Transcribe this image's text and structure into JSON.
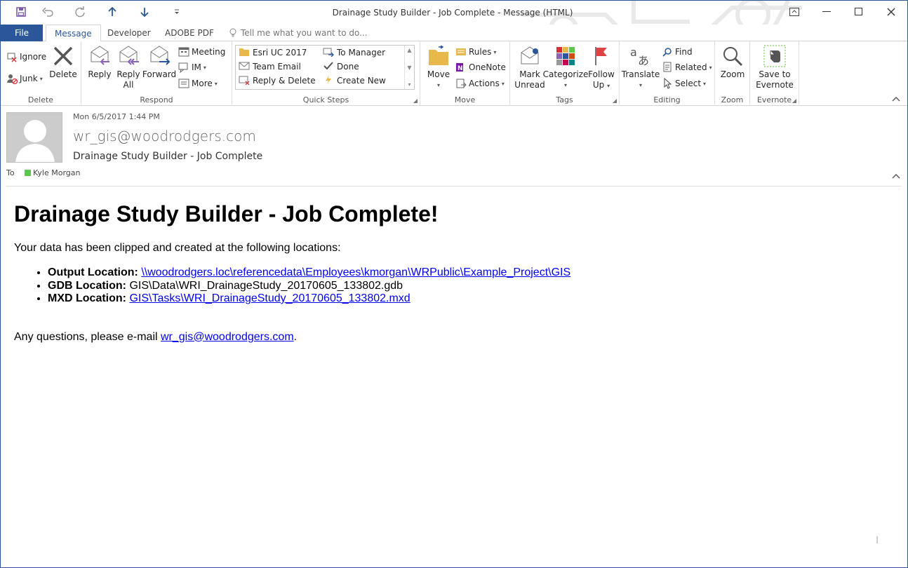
{
  "window": {
    "title": "Drainage Study Builder - Job Complete - Message (HTML)"
  },
  "qat": {
    "save_icon": "save-icon",
    "undo_icon": "undo-icon",
    "redo_icon": "redo-icon",
    "up_icon": "arrow-up-icon",
    "down_icon": "arrow-down-icon",
    "customize_icon": "customize-qat-icon"
  },
  "tabs": {
    "file": "File",
    "message": "Message",
    "developer": "Developer",
    "adobe": "ADOBE PDF",
    "tell_me": "Tell me what you want to do..."
  },
  "ribbon": {
    "delete_group": {
      "label": "Delete",
      "ignore": "Ignore",
      "junk": "Junk",
      "delete": "Delete"
    },
    "respond_group": {
      "label": "Respond",
      "reply": "Reply",
      "reply_all_1": "Reply",
      "reply_all_2": "All",
      "forward": "Forward",
      "meeting": "Meeting",
      "im": "IM",
      "more": "More"
    },
    "quick_steps_group": {
      "label": "Quick Steps",
      "items": [
        "Esri UC 2017",
        "Team Email",
        "Reply & Delete",
        "To Manager",
        "Done",
        "Create New"
      ]
    },
    "move_group": {
      "label": "Move",
      "move": "Move",
      "rules": "Rules",
      "onenote": "OneNote",
      "actions": "Actions"
    },
    "tags_group": {
      "label": "Tags",
      "mark_unread_1": "Mark",
      "mark_unread_2": "Unread",
      "categorize": "Categorize",
      "follow_up_1": "Follow",
      "follow_up_2": "Up"
    },
    "editing_group": {
      "label": "Editing",
      "translate": "Translate",
      "find": "Find",
      "related": "Related",
      "select": "Select"
    },
    "zoom_group": {
      "label": "Zoom",
      "zoom": "Zoom"
    },
    "evernote_group": {
      "label": "Evernote",
      "save_1": "Save to",
      "save_2": "Evernote"
    }
  },
  "message": {
    "date": "Mon 6/5/2017 1:44 PM",
    "from": "wr_gis@woodrodgers.com",
    "subject": "Drainage Study Builder - Job Complete",
    "to_label": "To",
    "to": "Kyle Morgan"
  },
  "body": {
    "heading": "Drainage Study Builder - Job Complete!",
    "intro": "Your data has been clipped and created at the following locations:",
    "output_label": "Output Location:",
    "output_value": "\\\\woodrodgers.loc\\referencedata\\Employees\\kmorgan\\WRPublic\\Example_Project\\GIS",
    "gdb_label": "GDB Location:",
    "gdb_value": "GIS\\Data\\WRI_DrainageStudy_20170605_133802.gdb",
    "mxd_label": "MXD Location:",
    "mxd_value": "GIS\\Tasks\\WRI_DrainageStudy_20170605_133802.mxd",
    "closing_prefix": "Any questions, please e-mail ",
    "closing_link": "wr_gis@woodrodgers.com",
    "closing_suffix": "."
  },
  "colors": {
    "accent": "#2b579a",
    "link": "#0000ee",
    "presence": "#5cc74a"
  }
}
